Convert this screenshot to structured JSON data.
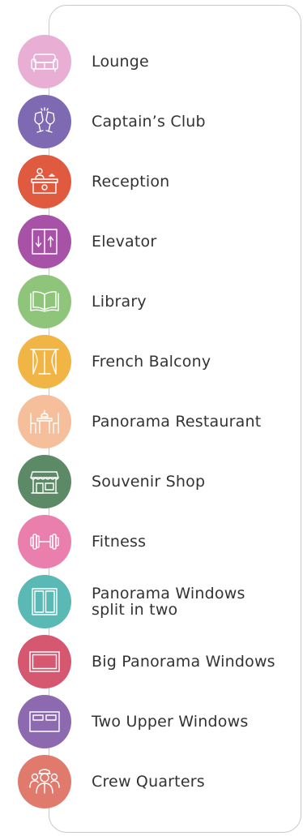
{
  "colors": {
    "border": "#c8c8c8",
    "text": "#333333"
  },
  "legend": {
    "items": [
      {
        "label": "Lounge",
        "icon": "sofa-icon",
        "color": "#e8aed3"
      },
      {
        "label": "Captain’s Club",
        "icon": "champagne-glasses-icon",
        "color": "#7e6ab3"
      },
      {
        "label": "Reception",
        "icon": "reception-desk-icon",
        "color": "#e05a3f"
      },
      {
        "label": "Elevator",
        "icon": "elevator-icon",
        "color": "#a852a7"
      },
      {
        "label": "Library",
        "icon": "open-book-icon",
        "color": "#8fc57a"
      },
      {
        "label": "French Balcony",
        "icon": "curtains-window-icon",
        "color": "#f1b545"
      },
      {
        "label": "Panorama Restaurant",
        "icon": "dining-table-icon",
        "color": "#f5bf9b"
      },
      {
        "label": "Souvenir Shop",
        "icon": "shop-storefront-icon",
        "color": "#5c8a67"
      },
      {
        "label": "Fitness",
        "icon": "dumbbell-icon",
        "color": "#ea7fae"
      },
      {
        "label": "Panorama Windows\nsplit in two",
        "icon": "split-window-icon",
        "color": "#5ab8b5"
      },
      {
        "label": "Big Panorama Windows",
        "icon": "big-window-icon",
        "color": "#d55770"
      },
      {
        "label": "Two Upper Windows",
        "icon": "two-upper-windows-icon",
        "color": "#8d6aaf"
      },
      {
        "label": "Crew Quarters",
        "icon": "crew-people-icon",
        "color": "#e07a6d"
      }
    ]
  }
}
